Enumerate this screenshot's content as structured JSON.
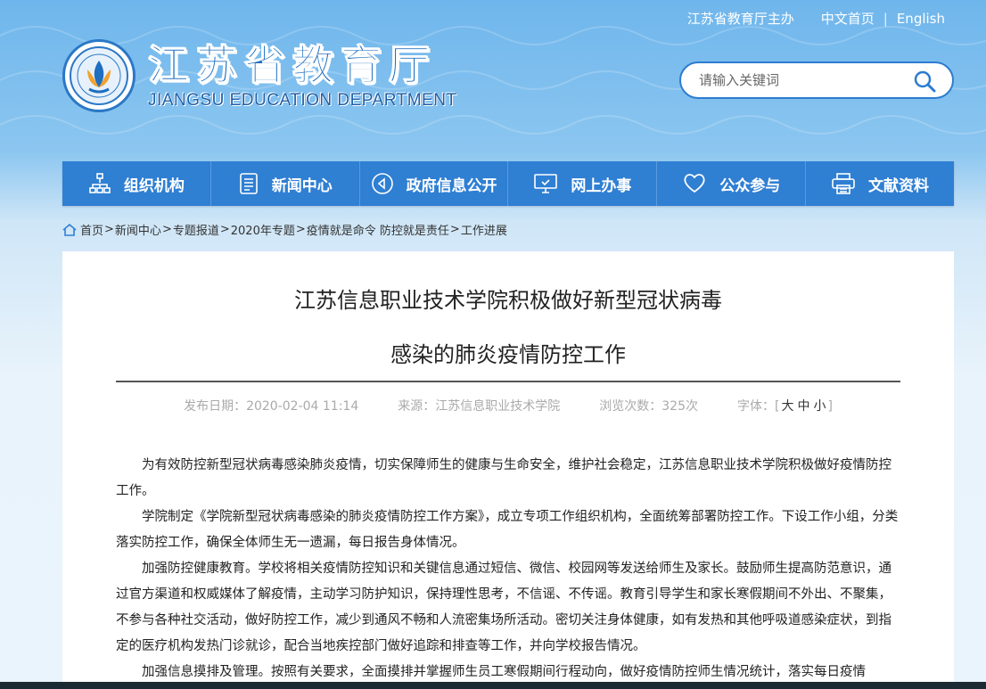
{
  "topbar": {
    "host": "江苏省教育厅主办",
    "links": [
      "中文首页",
      "English"
    ],
    "separator": "|"
  },
  "logo": {
    "name_cn": "江苏省教育厅",
    "name_en": "JIANGSU EDUCATION DEPARTMENT"
  },
  "search": {
    "placeholder": "请输入关键词"
  },
  "nav": {
    "items": [
      {
        "label": "组织机构",
        "icon": "org-chart-icon"
      },
      {
        "label": "新闻中心",
        "icon": "document-icon"
      },
      {
        "label": "政府信息公开",
        "icon": "sound-icon"
      },
      {
        "label": "网上办事",
        "icon": "monitor-icon"
      },
      {
        "label": "公众参与",
        "icon": "heart-icon"
      },
      {
        "label": "文献资料",
        "icon": "printer-icon"
      }
    ]
  },
  "breadcrumb": {
    "items": [
      "首页",
      "新闻中心",
      "专题报道",
      "2020年专题",
      "疫情就是命令 防控就是责任",
      "工作进展"
    ],
    "sep": ">"
  },
  "article": {
    "title_line1": "江苏信息职业技术学院积极做好新型冠状病毒",
    "title_line2": "感染的肺炎疫情防控工作",
    "publish_label": "发布日期：",
    "publish_date": "2020-02-04 11:14",
    "source_label": "来源：",
    "source": "江苏信息职业技术学院",
    "views_label": "浏览次数：",
    "views": "325次",
    "font_label": "字体：",
    "font_large": "大",
    "font_medium": "中",
    "font_small": "小",
    "paragraphs": [
      "为有效防控新型冠状病毒感染肺炎疫情，切实保障师生的健康与生命安全，维护社会稳定，江苏信息职业技术学院积极做好疫情防控工作。",
      "学院制定《学院新型冠状病毒感染的肺炎疫情防控工作方案》，成立专项工作组织机构，全面统筹部署防控工作。下设工作小组，分类落实防控工作，确保全体师生无一遗漏，每日报告身体情况。",
      "加强防控健康教育。学校将相关疫情防控知识和关键信息通过短信、微信、校园网等发送给师生及家长。鼓励师生提高防范意识，通过官方渠道和权威媒体了解疫情，主动学习防护知识，保持理性思考，不信谣、不传谣。教育引导学生和家长寒假期间不外出、不聚集，不参与各种社交活动，做好防控工作，减少到通风不畅和人流密集场所活动。密切关注身体健康，如有发热和其他呼吸道感染症状，到指定的医疗机构发热门诊就诊，配合当地疾控部门做好追踪和排查等工作，并向学校报告情况。",
      "加强信息摸排及管理。按照有关要求，全面摸排并掌握师生员工寒假期间行程动向，做好疫情防控师生情况统计，落实每日疫情"
    ]
  },
  "colors": {
    "nav_bg": "#2f7fd3",
    "accent": "#1f6ec0"
  }
}
